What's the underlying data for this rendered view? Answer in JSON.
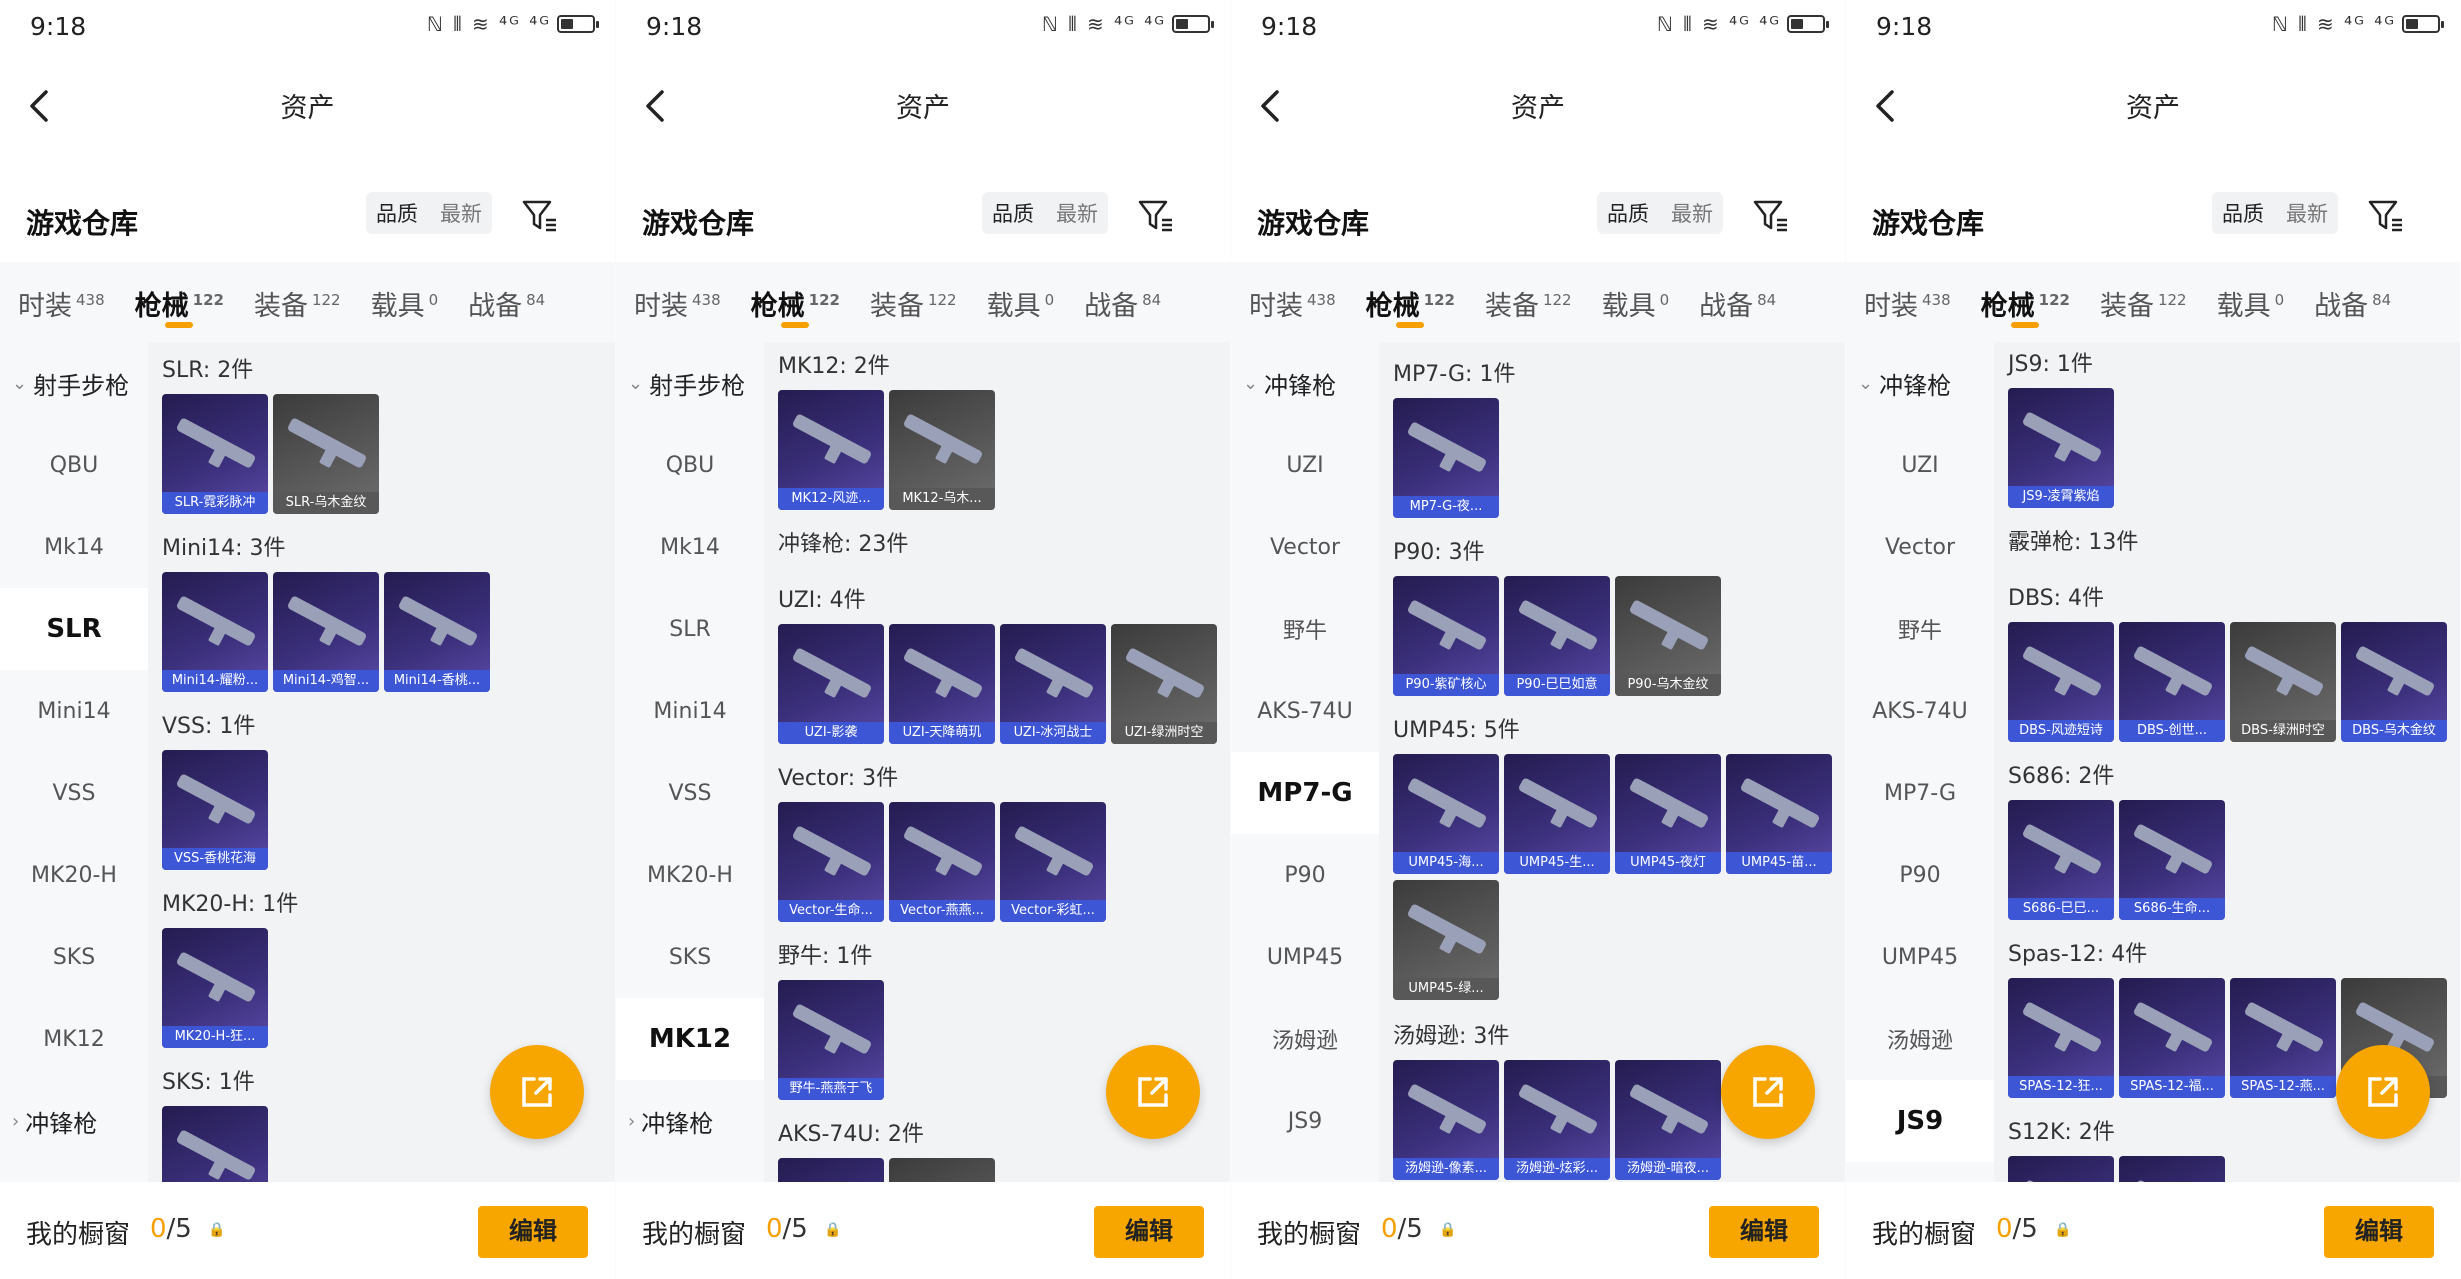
{
  "status": {
    "time": "9:18",
    "icons": "ℕ ⫴ ≋ ⁴ᴳ ⁴ᴳ"
  },
  "nav": {
    "title": "资产"
  },
  "header": {
    "title": "游戏仓库",
    "sort_quality": "品质",
    "sort_latest": "最新"
  },
  "tabs": [
    {
      "label": "时装",
      "count": "438"
    },
    {
      "label": "枪械",
      "count": "122"
    },
    {
      "label": "装备",
      "count": "122"
    },
    {
      "label": "载具",
      "count": "0"
    },
    {
      "label": "战备",
      "count": "84"
    }
  ],
  "bottom": {
    "label": "我的橱窗",
    "count_hl": "0",
    "count_rest": "/5",
    "edit": "编辑"
  },
  "icons": {
    "back": "chevron-left-icon",
    "filter": "filter-icon",
    "share": "share-icon",
    "lock": "lock-icon"
  },
  "colors": {
    "accent": "#f7a600",
    "card_purple": "#3a2f7a",
    "card_label": "#3d56d6"
  },
  "panels": [
    {
      "sidebar": [
        {
          "kind": "cat",
          "label": "射手步枪",
          "caret": "⌄"
        },
        {
          "kind": "item",
          "label": "QBU"
        },
        {
          "kind": "item",
          "label": "Mk14"
        },
        {
          "kind": "item",
          "label": "SLR",
          "active": true
        },
        {
          "kind": "item",
          "label": "Mini14"
        },
        {
          "kind": "item",
          "label": "VSS"
        },
        {
          "kind": "item",
          "label": "MK20-H"
        },
        {
          "kind": "item",
          "label": "SKS"
        },
        {
          "kind": "item",
          "label": "MK12"
        },
        {
          "kind": "cat",
          "label": "冲锋枪",
          "caret": "›"
        }
      ],
      "sections": [
        {
          "title": "SLR: 2件",
          "cards": [
            {
              "name": "SLR-霓彩脉冲"
            },
            {
              "name": "SLR-乌木金纹",
              "gray": true
            }
          ]
        },
        {
          "title": "Mini14: 3件",
          "cards": [
            {
              "name": "Mini14-耀粉..."
            },
            {
              "name": "Mini14-鸡智..."
            },
            {
              "name": "Mini14-香桃..."
            }
          ]
        },
        {
          "title": "VSS: 1件",
          "cards": [
            {
              "name": "VSS-香桃花海"
            }
          ]
        },
        {
          "title": "MK20-H: 1件",
          "cards": [
            {
              "name": "MK20-H-狂..."
            }
          ]
        },
        {
          "title": "SKS: 1件",
          "cards": [
            {
              "name": ""
            }
          ]
        }
      ]
    },
    {
      "sidebar": [
        {
          "kind": "cat",
          "label": "射手步枪",
          "caret": "⌄"
        },
        {
          "kind": "item",
          "label": "QBU"
        },
        {
          "kind": "item",
          "label": "Mk14"
        },
        {
          "kind": "item",
          "label": "SLR"
        },
        {
          "kind": "item",
          "label": "Mini14"
        },
        {
          "kind": "item",
          "label": "VSS"
        },
        {
          "kind": "item",
          "label": "MK20-H"
        },
        {
          "kind": "item",
          "label": "SKS"
        },
        {
          "kind": "item",
          "label": "MK12",
          "active": true
        },
        {
          "kind": "cat",
          "label": "冲锋枪",
          "caret": "›"
        }
      ],
      "sections": [
        {
          "title": "MK12: 2件",
          "cards": [
            {
              "name": "MK12-风迹..."
            },
            {
              "name": "MK12-乌木...",
              "gray": true
            }
          ]
        },
        {
          "title": "冲锋枪: 23件",
          "cards": []
        },
        {
          "title": "UZI: 4件",
          "cards": [
            {
              "name": "UZI-影袭"
            },
            {
              "name": "UZI-天降萌玑"
            },
            {
              "name": "UZI-冰河战士"
            },
            {
              "name": "UZI-绿洲时空",
              "gray": true
            }
          ]
        },
        {
          "title": "Vector: 3件",
          "cards": [
            {
              "name": "Vector-生命..."
            },
            {
              "name": "Vector-燕燕..."
            },
            {
              "name": "Vector-彩虹..."
            }
          ]
        },
        {
          "title": "野牛: 1件",
          "cards": [
            {
              "name": "野牛-燕燕于飞"
            }
          ]
        },
        {
          "title": "AKS-74U: 2件",
          "cards": [
            {
              "name": ""
            },
            {
              "name": "",
              "gray": true
            }
          ]
        }
      ]
    },
    {
      "sidebar": [
        {
          "kind": "cat",
          "label": "冲锋枪",
          "caret": "⌄"
        },
        {
          "kind": "item",
          "label": "UZI"
        },
        {
          "kind": "item",
          "label": "Vector"
        },
        {
          "kind": "item",
          "label": "野牛"
        },
        {
          "kind": "item",
          "label": "AKS-74U"
        },
        {
          "kind": "item",
          "label": "MP7-G",
          "active": true
        },
        {
          "kind": "item",
          "label": "P90"
        },
        {
          "kind": "item",
          "label": "UMP45"
        },
        {
          "kind": "item",
          "label": "汤姆逊"
        },
        {
          "kind": "item",
          "label": "JS9"
        }
      ],
      "sections": [
        {
          "title": "MP7-G: 1件",
          "cards": [
            {
              "name": "MP7-G-夜..."
            }
          ]
        },
        {
          "title": "P90: 3件",
          "cards": [
            {
              "name": "P90-紫矿核心"
            },
            {
              "name": "P90-巳巳如意"
            },
            {
              "name": "P90-乌木金纹",
              "gray": true
            }
          ]
        },
        {
          "title": "UMP45: 5件",
          "cards": [
            {
              "name": "UMP45-海..."
            },
            {
              "name": "UMP45-生..."
            },
            {
              "name": "UMP45-夜灯"
            },
            {
              "name": "UMP45-苗..."
            }
          ]
        },
        {
          "title": "",
          "cards": [
            {
              "name": "UMP45-绿...",
              "gray": true
            }
          ]
        },
        {
          "title": "汤姆逊: 3件",
          "cards": [
            {
              "name": "汤姆逊-像素..."
            },
            {
              "name": "汤姆逊-炫彩..."
            },
            {
              "name": "汤姆逊-暗夜..."
            }
          ]
        }
      ]
    },
    {
      "sidebar": [
        {
          "kind": "cat",
          "label": "冲锋枪",
          "caret": "⌄"
        },
        {
          "kind": "item",
          "label": "UZI"
        },
        {
          "kind": "item",
          "label": "Vector"
        },
        {
          "kind": "item",
          "label": "野牛"
        },
        {
          "kind": "item",
          "label": "AKS-74U"
        },
        {
          "kind": "item",
          "label": "MP7-G"
        },
        {
          "kind": "item",
          "label": "P90"
        },
        {
          "kind": "item",
          "label": "UMP45"
        },
        {
          "kind": "item",
          "label": "汤姆逊"
        },
        {
          "kind": "item",
          "label": "JS9",
          "active": true
        }
      ],
      "sections": [
        {
          "title": "JS9: 1件",
          "cards": [
            {
              "name": "JS9-凌霄紫焰"
            }
          ]
        },
        {
          "title": "霰弹枪: 13件",
          "cards": []
        },
        {
          "title": "DBS: 4件",
          "cards": [
            {
              "name": "DBS-风迹短诗"
            },
            {
              "name": "DBS-创世..."
            },
            {
              "name": "DBS-绿洲时空",
              "gray": true
            },
            {
              "name": "DBS-乌木金纹"
            }
          ]
        },
        {
          "title": "S686: 2件",
          "cards": [
            {
              "name": "S686-巳巳..."
            },
            {
              "name": "S686-生命..."
            }
          ]
        },
        {
          "title": "Spas-12: 4件",
          "cards": [
            {
              "name": "SPAS-12-狂..."
            },
            {
              "name": "SPAS-12-福..."
            },
            {
              "name": "SPAS-12-燕..."
            },
            {
              "name": "",
              "gray": true
            }
          ]
        },
        {
          "title": "S12K: 2件",
          "cards": [
            {
              "name": ""
            },
            {
              "name": ""
            }
          ]
        }
      ]
    }
  ]
}
